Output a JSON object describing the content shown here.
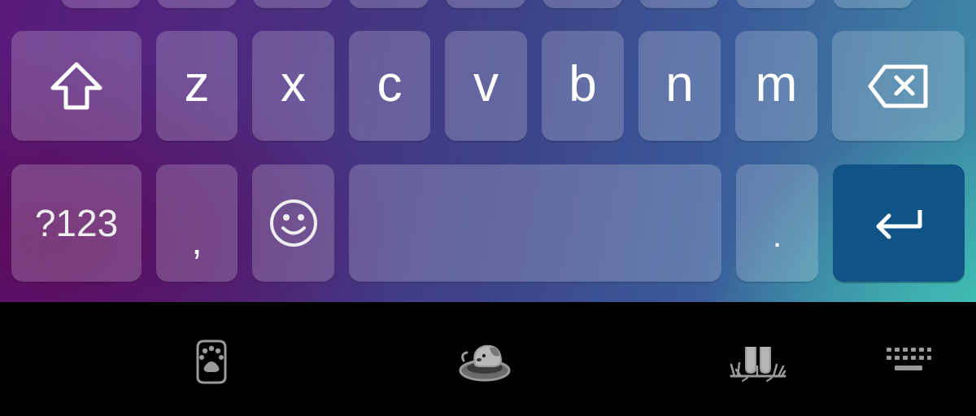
{
  "keyboard": {
    "row_letters": [
      "z",
      "x",
      "c",
      "v",
      "b",
      "n",
      "m"
    ],
    "symbols_key_label": "?123",
    "comma_key_label": ",",
    "period_key_label": "."
  },
  "icons": {
    "shift": "shift-arrow-icon",
    "backspace": "backspace-icon",
    "emoji": "smiley-face-icon",
    "enter": "enter-return-icon",
    "paw": "paw-print-icon",
    "puppy_bed": "puppy-in-bed-icon",
    "grass_paws": "paws-in-grass-icon",
    "keyboard_switch": "keyboard-icon"
  },
  "colors": {
    "enter_key": "#0f5387",
    "key_fill": "rgba(255,255,255,0.20)",
    "nav_icon": "#9a9a9a"
  }
}
